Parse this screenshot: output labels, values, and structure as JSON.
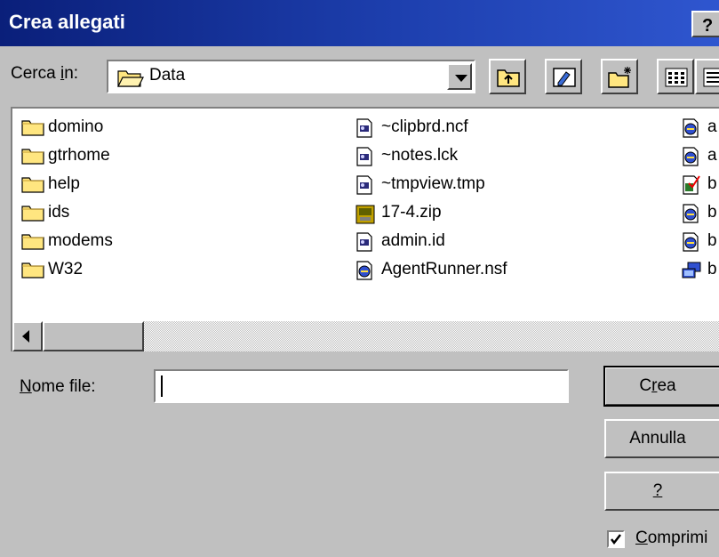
{
  "window": {
    "title": "Crea allegati",
    "help_button": "?"
  },
  "toolbar": {
    "look_in_label_pre": "Cerca ",
    "look_in_label_accel": "i",
    "look_in_label_post": "n:",
    "folder": "Data",
    "buttons": [
      "up-one-level-icon",
      "go-to-desktop-icon",
      "new-folder-icon",
      "list-view-icon",
      "details-view-icon"
    ]
  },
  "files": {
    "column1": [
      "domino",
      "gtrhome",
      "help",
      "ids",
      "modems",
      "W32"
    ],
    "column2": [
      "~clipbrd.ncf",
      "~notes.lck",
      "~tmpview.tmp",
      "17-4.zip",
      "admin.id",
      "AgentRunner.nsf"
    ],
    "column3": [
      "a",
      "a",
      "b",
      "b",
      "b",
      "b"
    ]
  },
  "filename": {
    "label_accel": "N",
    "label_rest": "ome file:",
    "value": ""
  },
  "buttons": {
    "create_pre": "C",
    "create_accel": "r",
    "create_post": "ea",
    "cancel": "Annulla",
    "help": "?"
  },
  "compress": {
    "checked": true,
    "label_accel": "C",
    "label_rest": "omprimi"
  }
}
